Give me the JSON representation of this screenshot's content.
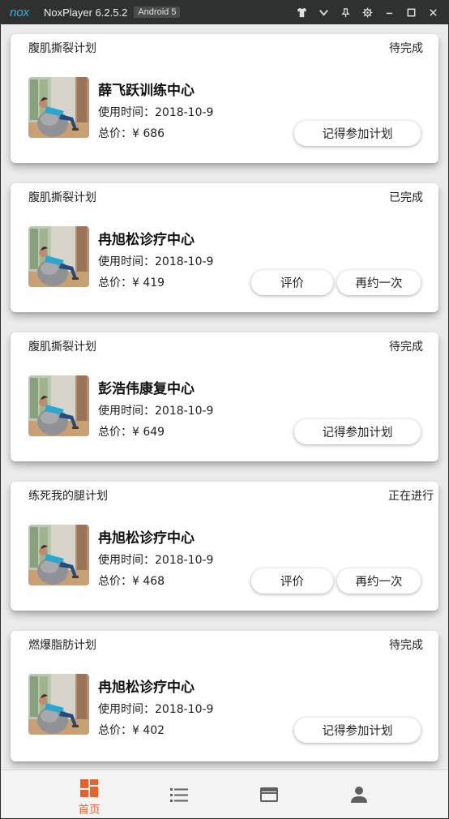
{
  "window": {
    "logo_text": "nox",
    "title": "NoxPlayer 6.2.5.2",
    "badge": "Android 5",
    "controls": [
      "shirt-icon",
      "chevron-down-icon",
      "pin-icon",
      "gear-icon",
      "minimize-icon",
      "maximize-icon",
      "close-icon"
    ]
  },
  "orders": [
    {
      "plan": "腹肌撕裂计划",
      "status": "待完成",
      "center": "薛飞跃训练中心",
      "time": "使用时间：2018-10-9",
      "price": "总价：¥ 686",
      "buttons": [
        "记得参加计划"
      ]
    },
    {
      "plan": "腹肌撕裂计划",
      "status": "已完成",
      "center": "冉旭松诊疗中心",
      "time": "使用时间：2018-10-9",
      "price": "总价：¥ 419",
      "buttons": [
        "评价",
        "再约一次"
      ]
    },
    {
      "plan": "腹肌撕裂计划",
      "status": "待完成",
      "center": "彭浩伟康复中心",
      "time": "使用时间：2018-10-9",
      "price": "总价：¥ 649",
      "buttons": [
        "记得参加计划"
      ]
    },
    {
      "plan": "练死我的腿计划",
      "status": "正在进行",
      "center": "冉旭松诊疗中心",
      "time": "使用时间：2018-10-9",
      "price": "总价：¥ 468",
      "buttons": [
        "评价",
        "再约一次"
      ]
    },
    {
      "plan": "燃爆脂肪计划",
      "status": "待完成",
      "center": "冉旭松诊疗中心",
      "time": "使用时间：2018-10-9",
      "price": "总价：¥ 402",
      "buttons": [
        "记得参加计划"
      ]
    }
  ],
  "nav": {
    "items": [
      {
        "icon": "dashboard-icon",
        "label": "首页",
        "active": true
      },
      {
        "icon": "list-icon",
        "label": "",
        "active": false
      },
      {
        "icon": "card-icon",
        "label": "",
        "active": false
      },
      {
        "icon": "user-icon",
        "label": "",
        "active": false
      }
    ]
  },
  "colors": {
    "accent": "#e8632c",
    "icon_gray": "#5f5f5f",
    "titlebar": "#2f3030"
  }
}
